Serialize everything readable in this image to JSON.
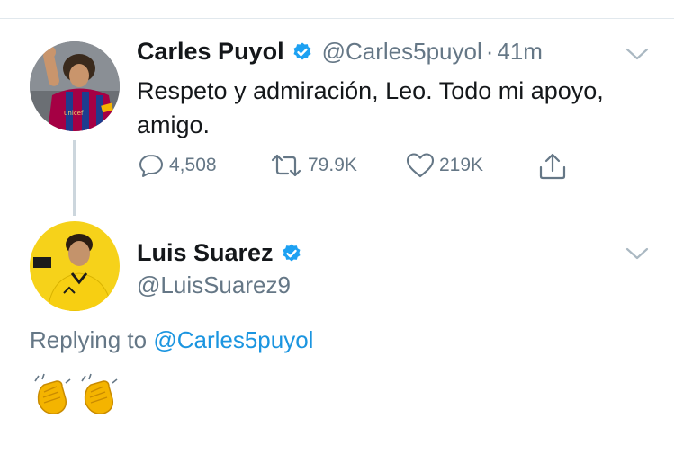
{
  "tweet": {
    "author_name": "Carles Puyol",
    "author_handle": "@Carles5puyol",
    "separator": "·",
    "timestamp": "41m",
    "text": "Respeto y admiración, Leo. Todo mi apoyo, amigo.",
    "actions": {
      "replies": "4,508",
      "retweets": "79.9K",
      "likes": "219K"
    },
    "icons": [
      "verified-badge-icon",
      "chevron-down-icon",
      "reply-icon",
      "retweet-icon",
      "like-icon",
      "share-icon"
    ]
  },
  "reply": {
    "author_name": "Luis Suarez",
    "author_handle": "@LuisSuarez9",
    "replying_prefix": "Replying to",
    "replying_to": "@Carles5puyol",
    "emoji": [
      "clapping-hands-emoji",
      "clapping-hands-emoji"
    ]
  },
  "colors": {
    "text_primary": "#14171a",
    "text_secondary": "#657786",
    "link": "#1b95e0",
    "verified": "#1da1f2",
    "divider": "#e1e8ed",
    "thread_line": "#ccd6dd"
  }
}
